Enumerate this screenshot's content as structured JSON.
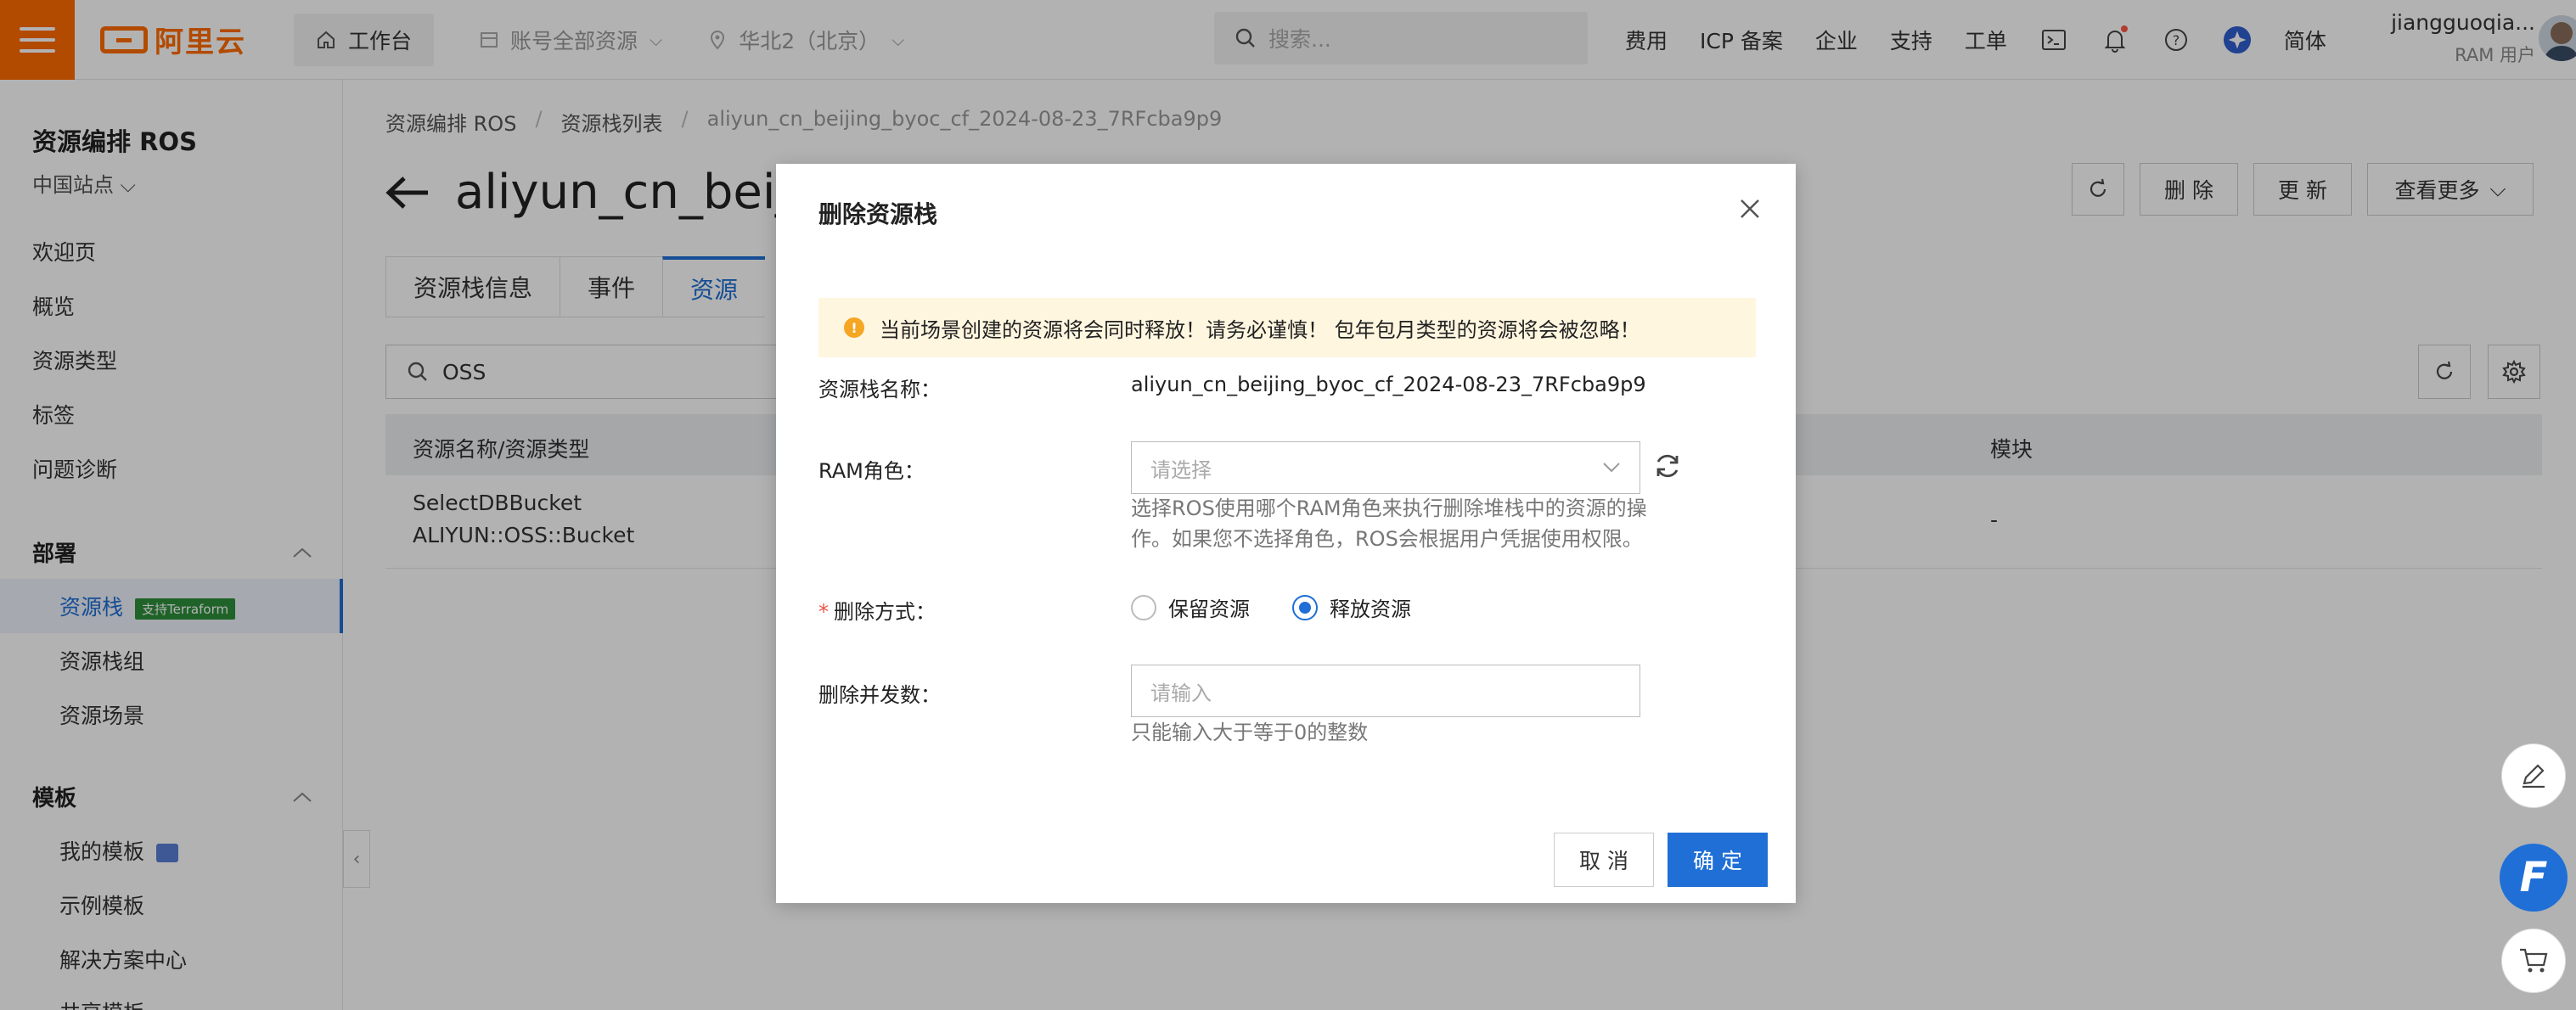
{
  "topbar": {
    "logo_text": "阿里云",
    "workbench": "工作台",
    "resource_scope": "账号全部资源",
    "region": "华北2（北京）",
    "search_placeholder": "搜索...",
    "links": [
      "费用",
      "ICP 备案",
      "企业",
      "支持",
      "工单"
    ],
    "language": "简体",
    "user_name": "jiangguoqia...",
    "user_role": "RAM 用户"
  },
  "sidebar": {
    "title": "资源编排 ROS",
    "site": "中国站点",
    "items": [
      "欢迎页",
      "概览",
      "资源类型",
      "标签",
      "问题诊断"
    ],
    "section_deploy": "部署",
    "deploy_items": [
      "资源栈",
      "资源栈组",
      "资源场景"
    ],
    "terraform_badge": "支持Terraform",
    "section_template": "模板",
    "template_items": [
      "我的模板",
      "示例模板",
      "解决方案中心",
      "共享模板"
    ]
  },
  "main": {
    "breadcrumb": [
      "资源编排 ROS",
      "资源栈列表",
      "aliyun_cn_beijing_byoc_cf_2024-08-23_7RFcba9p9"
    ],
    "page_title": "aliyun_cn_beijing",
    "tabs": [
      "资源栈信息",
      "事件",
      "资源"
    ],
    "active_tab": "资源",
    "search_value": "OSS",
    "buttons": {
      "delete": "删 除",
      "update": "更 新",
      "more": "查看更多"
    },
    "table": {
      "headers": [
        "资源名称/资源类型",
        "模块"
      ],
      "rows": [
        {
          "name": "SelectDBBucket",
          "type": "ALIYUN::OSS::Bucket",
          "module": "-"
        }
      ]
    }
  },
  "modal": {
    "title": "删除资源栈",
    "alert": "当前场景创建的资源将会同时释放！请务必谨慎！ 包年包月类型的资源将会被忽略！",
    "stack_name_label": "资源栈名称：",
    "stack_name": "aliyun_cn_beijing_byoc_cf_2024-08-23_7RFcba9p9",
    "ram_label": "RAM角色：",
    "ram_placeholder": "请选择",
    "ram_help_1": "选择ROS使用哪个RAM角色来执行删除堆栈中的资源的操",
    "ram_help_2": "作。如果您不选择角色，ROS会根据用户凭据使用权限。",
    "delete_mode_label": "删除方式：",
    "required_mark": "*",
    "option_keep": "保留资源",
    "option_release": "释放资源",
    "selected_option": "释放资源",
    "concurrency_label": "删除并发数：",
    "concurrency_placeholder": "请输入",
    "concurrency_help": "只能输入大于等于0的整数",
    "cancel": "取 消",
    "confirm": "确 定"
  }
}
